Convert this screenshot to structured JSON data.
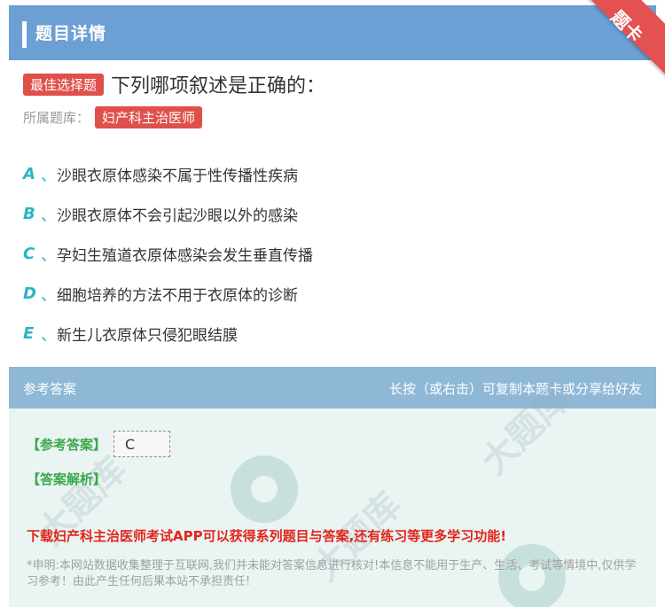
{
  "header": {
    "title": "题目详情"
  },
  "ribbon": {
    "label": "题卡"
  },
  "question": {
    "type_tag": "最佳选择题",
    "text": "下列哪项叙述是正确的：",
    "bank_label": "所属题库：",
    "bank_name": "妇产科主治医师"
  },
  "options": [
    {
      "letter": "A",
      "sep": "、",
      "text": "沙眼衣原体感染不属于性传播性疾病"
    },
    {
      "letter": "B",
      "sep": "、",
      "text": "沙眼衣原体不会引起沙眼以外的感染"
    },
    {
      "letter": "C",
      "sep": "、",
      "text": "孕妇生殖道衣原体感染会发生垂直传播"
    },
    {
      "letter": "D",
      "sep": "、",
      "text": "细胞培养的方法不用于衣原体的诊断"
    },
    {
      "letter": "E",
      "sep": "、",
      "text": "新生儿衣原体只侵犯眼结膜"
    }
  ],
  "answer_panel": {
    "title": "参考答案",
    "hint": "长按（或右击）可复制本题卡或分享给好友",
    "answer_label": "【参考答案】",
    "answer_value": "C",
    "analysis_label": "【答案解析】",
    "promo": "下载妇产科主治医师考试APP可以获得系列题目与答案,还有练习等更多学习功能!",
    "disclaimer": "*申明:本网站数据收集整理于互联网,我们并未能对答案信息进行核对!本信息不能用于生产、生活、考试等情境中,仅供学习参考！由此产生任何后果本站不承担责任!"
  },
  "colors": {
    "header_bg": "#6c9fd3",
    "ribbon_bg": "#e35151",
    "tag_red": "#e0504a",
    "option_letter": "#2bb5c4",
    "answer_green": "#3aa84b",
    "promo_red": "#e3241b"
  }
}
